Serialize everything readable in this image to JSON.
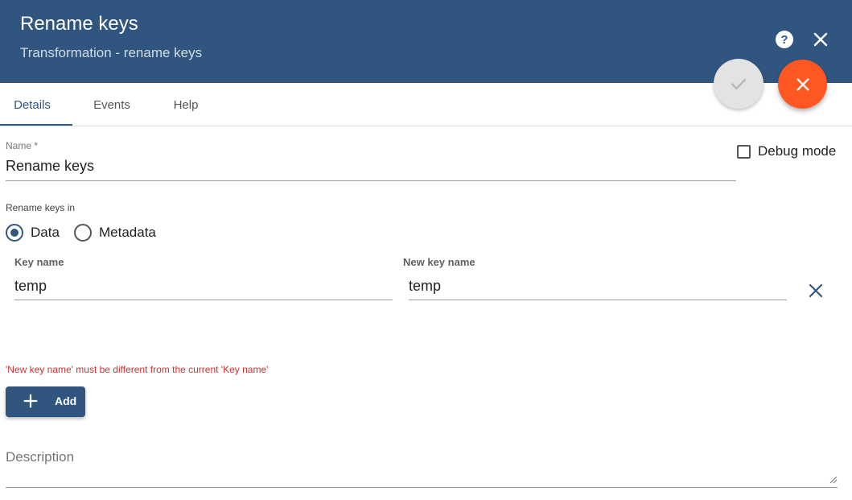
{
  "header": {
    "title": "Rename keys",
    "subtitle": "Transformation - rename keys",
    "help_icon": "help-circle-icon",
    "close_icon": "close-icon",
    "background": "#305680"
  },
  "actions": {
    "confirm_icon": "check-icon",
    "cancel_icon": "close-icon",
    "cancel_color": "#ff5722"
  },
  "tabs": [
    {
      "label": "Details",
      "active": true
    },
    {
      "label": "Events",
      "active": false
    },
    {
      "label": "Help",
      "active": false
    }
  ],
  "form": {
    "name_label": "Name *",
    "name_value": "Rename keys",
    "debug_mode_label": "Debug mode",
    "debug_mode_checked": false,
    "rename_keys_in_label": "Rename keys in",
    "radio_options": [
      {
        "label": "Data",
        "checked": true
      },
      {
        "label": "Metadata",
        "checked": false
      }
    ],
    "mapping": {
      "key_name_label": "Key name",
      "key_name_value": "temp",
      "new_key_name_label": "New key name",
      "new_key_name_value": "temp"
    },
    "error_message": "'New key name' must be different from the current 'Key name'",
    "add_label": "Add",
    "description_label": "Description"
  }
}
